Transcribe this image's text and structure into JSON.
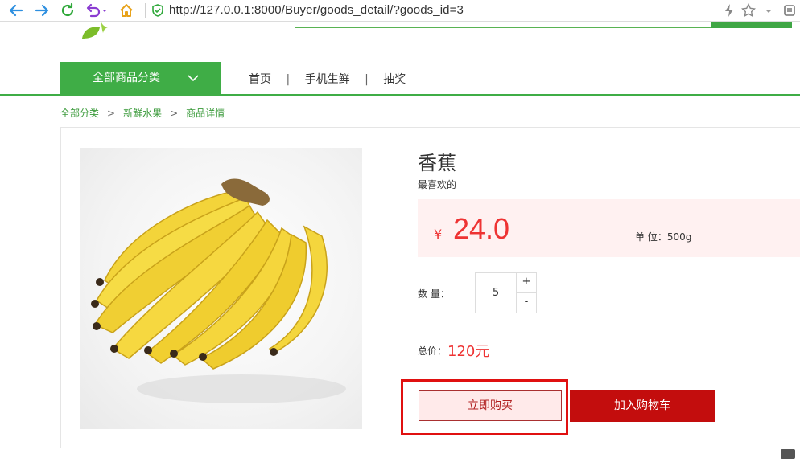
{
  "browser": {
    "url": "http://127.0.0.1:8000/Buyer/goods_detail/?goods_id=3"
  },
  "header": {
    "category_button": "全部商品分类",
    "nav": [
      "首页",
      "手机生鲜",
      "抽奖"
    ],
    "nav_separator": "|"
  },
  "breadcrumb": {
    "items": [
      "全部分类",
      "新鲜水果",
      "商品详情"
    ],
    "separator": ">"
  },
  "product": {
    "name": "香蕉",
    "description": "最喜欢的",
    "currency_symbol": "¥",
    "price": "24.0",
    "unit_label": "单 位：500g",
    "quantity_label": "数 量：",
    "quantity": "5",
    "plus_label": "+",
    "minus_label": "-",
    "total_label": "总价：",
    "total_value": "120元",
    "buy_now_label": "立即购买",
    "add_to_cart_label": "加入购物车"
  },
  "colors": {
    "brand_green": "#3fad46",
    "price_red": "#e33333",
    "cart_button_red": "#c30d0d",
    "highlight_red": "#e01010"
  },
  "icons": [
    "back-arrow-icon",
    "forward-arrow-icon",
    "reload-icon",
    "undo-icon",
    "home-icon",
    "secure-shield-icon",
    "lightning-icon",
    "star-icon",
    "chevron-down-icon",
    "menu-icon",
    "logo-leaf-icon",
    "category-chevron-icon"
  ]
}
